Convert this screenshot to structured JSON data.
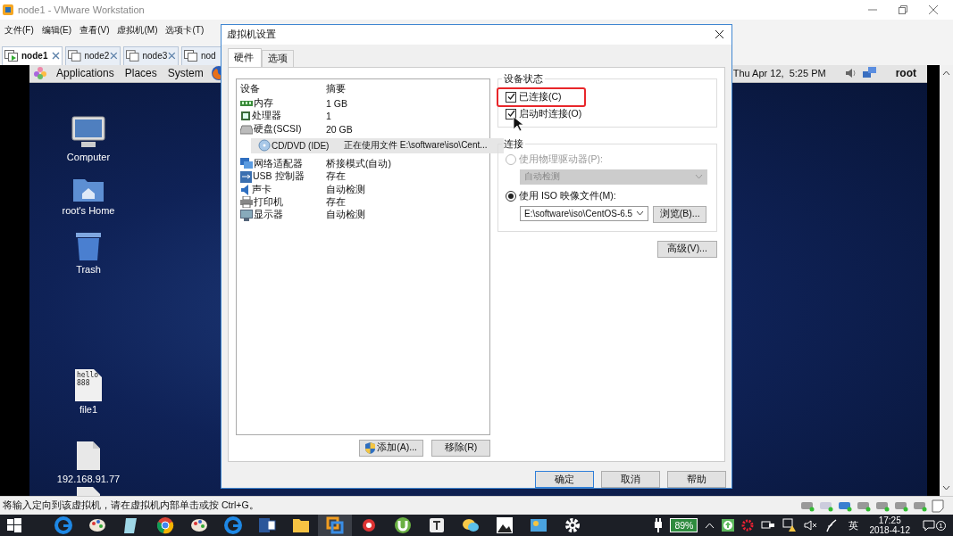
{
  "window": {
    "title": "node1 - VMware Workstation"
  },
  "menu": [
    "文件(F)",
    "编辑(E)",
    "查看(V)",
    "虚拟机(M)",
    "选项卡(T)"
  ],
  "vm_tabs": [
    {
      "label": "node1",
      "selected": true
    },
    {
      "label": "node2",
      "selected": false
    },
    {
      "label": "node3",
      "selected": false
    },
    {
      "label": "nod",
      "selected": false
    }
  ],
  "guest": {
    "panel_menus": [
      "Applications",
      "Places",
      "System"
    ],
    "clock": "Thu Apr 12,  5:25 PM",
    "user": "root",
    "desktop_icons": [
      {
        "kind": "computer",
        "label": "Computer"
      },
      {
        "kind": "home",
        "label": "root's Home"
      },
      {
        "kind": "trash",
        "label": "Trash"
      },
      {
        "kind": "text-file",
        "label": "file1",
        "preview": [
          "hello",
          "888"
        ]
      },
      {
        "kind": "file",
        "label": "192.168.91.77"
      }
    ]
  },
  "dialog": {
    "title": "虚拟机设置",
    "tabs": [
      {
        "label": "硬件",
        "selected": true
      },
      {
        "label": "选项",
        "selected": false
      }
    ],
    "devices": {
      "columns": [
        "设备",
        "摘要"
      ],
      "rows": [
        {
          "kind": "memory",
          "name": "内存",
          "summary": "1 GB",
          "selected": false
        },
        {
          "kind": "cpu",
          "name": "处理器",
          "summary": "1",
          "selected": false
        },
        {
          "kind": "disk",
          "name": "硬盘(SCSI)",
          "summary": "20 GB",
          "selected": false
        },
        {
          "kind": "cd",
          "name": "CD/DVD (IDE)",
          "summary": "正在使用文件 E:\\software\\iso\\Cent...",
          "selected": true
        },
        {
          "kind": "network",
          "name": "网络适配器",
          "summary": "桥接模式(自动)",
          "selected": false
        },
        {
          "kind": "usb",
          "name": "USB 控制器",
          "summary": "存在",
          "selected": false
        },
        {
          "kind": "sound",
          "name": "声卡",
          "summary": "自动检测",
          "selected": false
        },
        {
          "kind": "printer",
          "name": "打印机",
          "summary": "存在",
          "selected": false
        },
        {
          "kind": "display",
          "name": "显示器",
          "summary": "自动检测",
          "selected": false
        }
      ]
    },
    "add_button": "添加(A)...",
    "remove_button": "移除(R)",
    "device_status": {
      "title": "设备状态",
      "options": [
        {
          "label": "已连接(C)",
          "checked": true,
          "highlighted": true
        },
        {
          "label": "启动时连接(O)",
          "checked": true,
          "highlighted": false
        }
      ]
    },
    "connection": {
      "title": "连接",
      "options": [
        {
          "label": "使用物理驱动器(P):",
          "selected": false,
          "disabled": true
        },
        {
          "label": "使用 ISO 映像文件(M):",
          "selected": true,
          "disabled": false
        }
      ],
      "drive_select": "自动检测",
      "iso_select": "E:\\software\\iso\\CentOS-6.5",
      "browse_button": "浏览(B)..."
    },
    "advanced_button": "高级(V)...",
    "buttons": [
      "确定",
      "取消",
      "帮助"
    ]
  },
  "status_bar": {
    "message": "将输入定向到该虚拟机，请在虚拟机内部单击或按 Ctrl+G。"
  },
  "taskbar": {
    "battery": "89%",
    "ime": "英",
    "time": "17:25",
    "date": "2018-4-12",
    "notifications": "1"
  }
}
